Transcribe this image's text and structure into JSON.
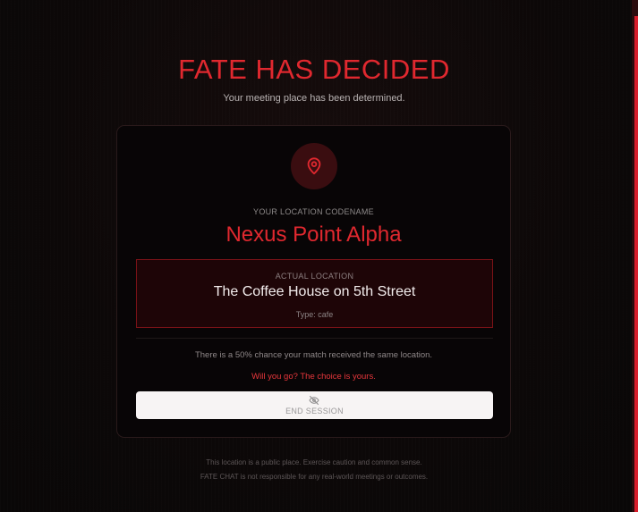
{
  "header": {
    "title": "FATE HAS DECIDED",
    "subtitle": "Your meeting place has been determined."
  },
  "card": {
    "icon": "map-pin-icon",
    "codename_label": "YOUR LOCATION CODENAME",
    "codename": "Nexus Point Alpha",
    "location": {
      "label": "ACTUAL LOCATION",
      "name": "The Coffee House on 5th Street",
      "type": "Type: cafe"
    },
    "chance_text": "There is a 50% chance your match received the same location.",
    "choice_text": "Will you go? The choice is yours.",
    "end_button": {
      "icon": "eye-off-icon",
      "label": "END SESSION"
    }
  },
  "footer": {
    "line1": "This location is a public place. Exercise caution and common sense.",
    "line2": "FATE CHAT is not responsible for any real-world meetings or outcomes."
  },
  "colors": {
    "accent": "#e0282f",
    "background": "#0b0808",
    "location_box_bg": "#1e0507",
    "location_box_border": "#7a1217"
  }
}
